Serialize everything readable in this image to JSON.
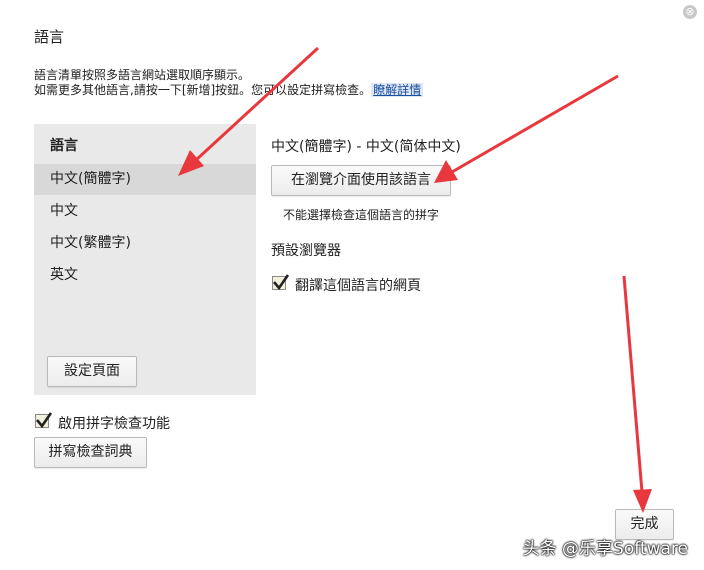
{
  "dialog": {
    "title": "語言",
    "intro_line1": "語言清單按照多語言網站選取順序顯示。",
    "intro_line2": "如需更多其他語言,請按一下[新增]按鈕。您可以設定拼寫檢查。",
    "learn_more": "瞭解詳情",
    "close_icon": "⊗"
  },
  "sidebar": {
    "header": "語言",
    "items": [
      {
        "label": "中文(簡體字)",
        "selected": true
      },
      {
        "label": "中文"
      },
      {
        "label": "中文(繁體字)"
      },
      {
        "label": "英文"
      }
    ],
    "settings_button": "設定頁面"
  },
  "detail": {
    "heading": "中文(簡體字) - 中文(简体中文)",
    "use_ui_button": "在瀏覽介面使用該語言",
    "spell_note": "不能選擇檢查這個語言的拼字",
    "default_browser_label": "預設瀏覽器",
    "translate_checkbox": {
      "label": "翻譯這個語言的網頁",
      "checked": true
    }
  },
  "footer": {
    "spellcheck_checkbox": {
      "label": "啟用拼字檢查功能",
      "checked": true
    },
    "dictionary_button": "拼寫檢查詞典",
    "done_button": "完成"
  },
  "watermark": "头条 @乐享Software",
  "colors": {
    "arrow": "#e8383d",
    "sidebar_bg": "#e9e9e9",
    "selected_bg": "#d8d8d8",
    "link": "#1a4fa0"
  }
}
